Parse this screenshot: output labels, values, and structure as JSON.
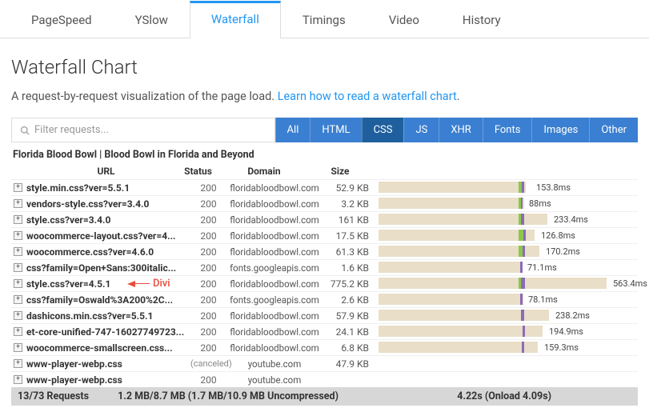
{
  "tabs": [
    "PageSpeed",
    "YSlow",
    "Waterfall",
    "Timings",
    "Video",
    "History"
  ],
  "activeTab": 2,
  "heading": "Waterfall Chart",
  "subtitle_text": "A request-by-request visualization of the page load. ",
  "subtitle_link": "Learn how to read a waterfall chart",
  "filter": {
    "placeholder": "Filter requests..."
  },
  "filters": [
    "All",
    "HTML",
    "CSS",
    "JS",
    "XHR",
    "Fonts",
    "Images",
    "Other"
  ],
  "activeFilter": 2,
  "pageTitle": "Florida Blood Bowl | Blood Bowl in Florida and Beyond",
  "headers": {
    "url": "URL",
    "status": "Status",
    "domain": "Domain",
    "size": "Size"
  },
  "rows": [
    {
      "url": "style.min.css?ver=5.5.1",
      "status": "200",
      "domain": "floridabloodbowl.com",
      "size": "52.9 KB",
      "wf": {
        "trackW": 9,
        "waitW": 4,
        "recvL": 4,
        "recvW": 3,
        "lblL": 22,
        "lbl": "153.8ms"
      },
      "bold": true
    },
    {
      "url": "vendors-style.css?ver=3.4.0",
      "status": "200",
      "domain": "floridabloodbowl.com",
      "size": "3.2 KB",
      "wf": {
        "trackW": 7,
        "waitW": 3,
        "recvL": 3,
        "recvW": 2,
        "lblL": 13,
        "lbl": "88ms"
      },
      "bold": true
    },
    {
      "url": "style.css?ver=3.4.0",
      "status": "200",
      "domain": "floridabloodbowl.com",
      "size": "161 KB",
      "wf": {
        "trackW": 36,
        "waitW": 3,
        "recvL": 3,
        "recvW": 4,
        "lblL": 44,
        "lbl": "233.4ms"
      },
      "bold": true
    },
    {
      "url": "woocommerce-layout.css?ver=4...",
      "status": "200",
      "domain": "floridabloodbowl.com",
      "size": "17.5 KB",
      "wf": {
        "trackW": 20,
        "waitW": 6,
        "recvL": 6,
        "recvW": 3,
        "lblL": 28,
        "lbl": "126.8ms"
      },
      "bold": true
    },
    {
      "url": "woocommerce.css?ver=4.6.0",
      "status": "200",
      "domain": "floridabloodbowl.com",
      "size": "61.3 KB",
      "wf": {
        "trackW": 26,
        "waitW": 5,
        "recvL": 5,
        "recvW": 3,
        "lblL": 34,
        "lbl": "170.2ms"
      },
      "bold": true
    },
    {
      "url": "css?family=Open+Sans:300italic...",
      "status": "200",
      "domain": "fonts.googleapis.com",
      "size": "1.6 KB",
      "wf": {
        "trackW": 5,
        "waitW": 0,
        "recvL": 2,
        "recvW": 3,
        "lblL": 11,
        "lbl": "71.1ms"
      },
      "bold": true
    },
    {
      "url": "style.css?ver=4.5.1",
      "status": "200",
      "domain": "floridabloodbowl.com",
      "size": "775.2 KB",
      "wf": {
        "trackW": 110,
        "waitW": 3,
        "recvL": 3,
        "recvW": 5,
        "lblL": 118,
        "lbl": "563.4ms"
      },
      "bold": true,
      "annot": "Divi"
    },
    {
      "url": "css?family=Oswald%3A200%2C...",
      "status": "200",
      "domain": "fonts.googleapis.com",
      "size": "2.6 KB",
      "wf": {
        "trackW": 6,
        "waitW": 0,
        "recvL": 2,
        "recvW": 3,
        "lblL": 12,
        "lbl": "78.1ms"
      },
      "bold": true
    },
    {
      "url": "dashicons.min.css?ver=5.5.1",
      "status": "200",
      "domain": "floridabloodbowl.com",
      "size": "57.9 KB",
      "wf": {
        "trackW": 38,
        "waitW": 0,
        "recvL": 3,
        "recvW": 4,
        "lblL": 46,
        "lbl": "238.2ms"
      },
      "bold": true
    },
    {
      "url": "et-core-unified-747-16027749723...",
      "status": "200",
      "domain": "floridabloodbowl.com",
      "size": "24.1 KB",
      "wf": {
        "trackW": 30,
        "waitW": 0,
        "recvL": 5,
        "recvW": 3,
        "lblL": 38,
        "lbl": "194.9ms"
      },
      "bold": true
    },
    {
      "url": "woocommerce-smallscreen.css...",
      "status": "200",
      "domain": "floridabloodbowl.com",
      "size": "6.8 KB",
      "wf": {
        "trackW": 24,
        "waitW": 0,
        "recvL": 4,
        "recvW": 3,
        "lblL": 32,
        "lbl": "159.3ms"
      },
      "bold": true
    },
    {
      "url": "www-player-webp.css",
      "status": "(canceled)",
      "domain": "youtube.com",
      "size": "47.9 KB",
      "bold": true,
      "cancel": true
    },
    {
      "url": "www-player-webp.css",
      "status": "200",
      "domain": "youtube.com",
      "size": "",
      "bold": true
    }
  ],
  "footer": {
    "req": "13/73 Requests",
    "size": "1.2 MB/8.7 MB  (1.7 MB/10.9 MB Uncompressed)",
    "time": "4.22s  (Onload 4.09s)"
  },
  "wfStart": 175
}
